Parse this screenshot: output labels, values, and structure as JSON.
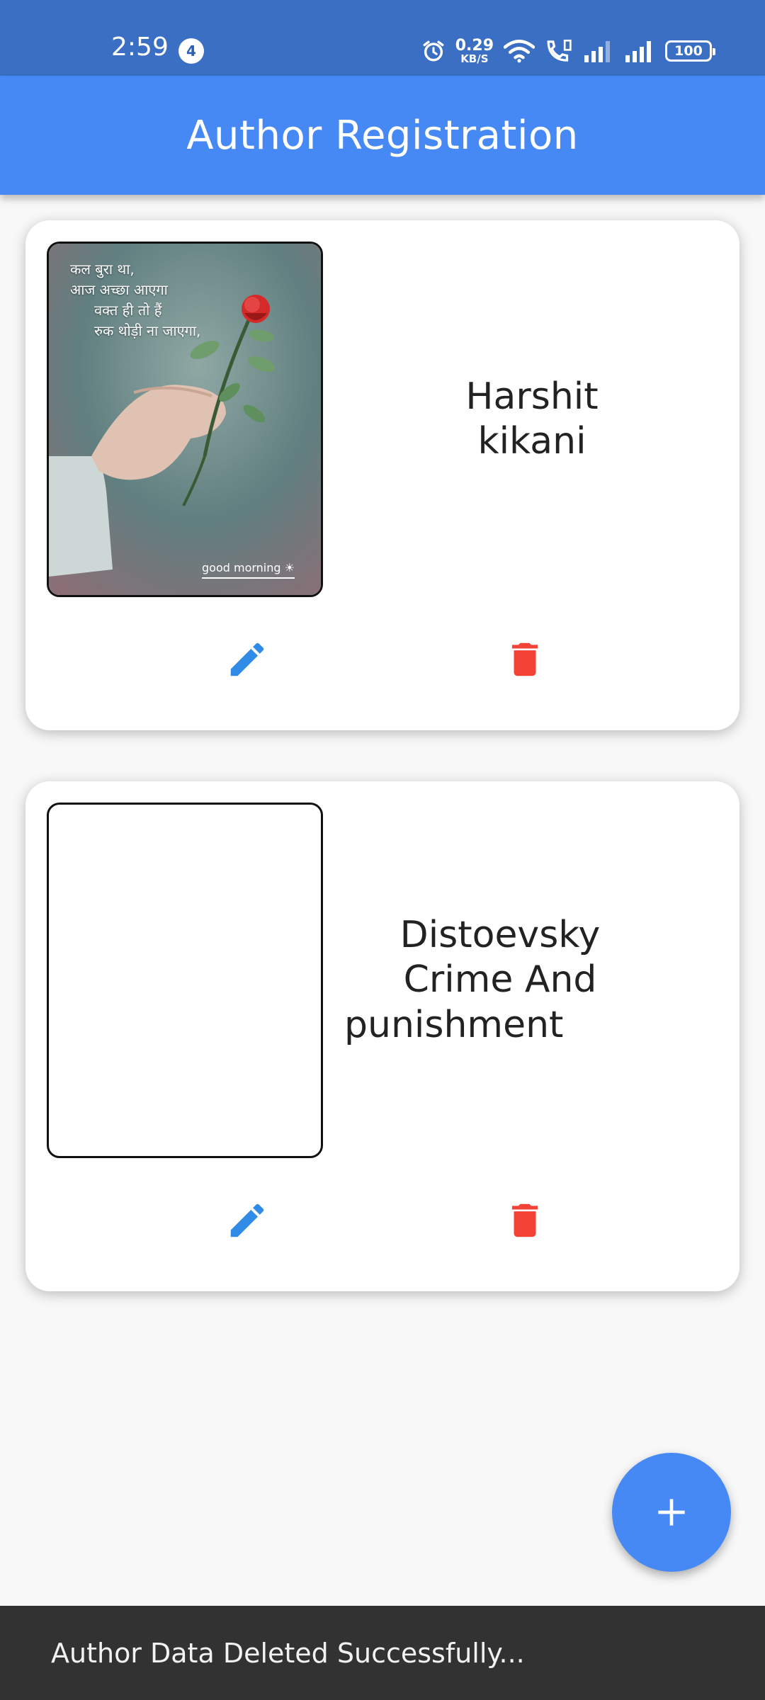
{
  "status_bar": {
    "time": "2:59",
    "notification_count": "4",
    "net_speed_value": "0.29",
    "net_speed_unit": "KB/S",
    "battery": "100"
  },
  "app_bar": {
    "title": "Author Registration"
  },
  "authors": [
    {
      "name": "Harshit kikani",
      "image_text": [
        "कल बुरा था,",
        "आज अच्छा आएगा",
        "वक्त ही तो हैं",
        "रुक थोड़ी ना जाएगा,"
      ],
      "image_caption": "good morning ☀",
      "has_image": true
    },
    {
      "name": "Distoevsky Crime And punishment",
      "has_image": false
    }
  ],
  "fab": {
    "icon": "plus-icon"
  },
  "snackbar": {
    "message": "Author Data Deleted Successfully..."
  },
  "colors": {
    "status_bar": "#3a6fc4",
    "app_bar": "#4689f5",
    "edit_icon": "#2f8be6",
    "delete_icon": "#f44336",
    "snackbar": "#323232"
  }
}
